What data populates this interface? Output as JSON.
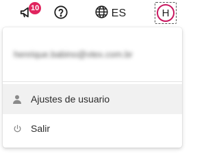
{
  "topbar": {
    "notifications": {
      "icon": "megaphone-icon",
      "count": "10",
      "badge_color": "#e0245e"
    },
    "help": {
      "icon": "help-circle-icon"
    },
    "language": {
      "icon": "globe-icon",
      "label": "ES"
    },
    "avatar": {
      "initial": "H",
      "ring_color": "#c8175f"
    }
  },
  "menu": {
    "email": "henrique.babino@vtex.com.br",
    "items": [
      {
        "icon": "user-icon",
        "label": "Ajustes de usuario"
      },
      {
        "icon": "power-icon",
        "label": "Salir"
      }
    ]
  }
}
